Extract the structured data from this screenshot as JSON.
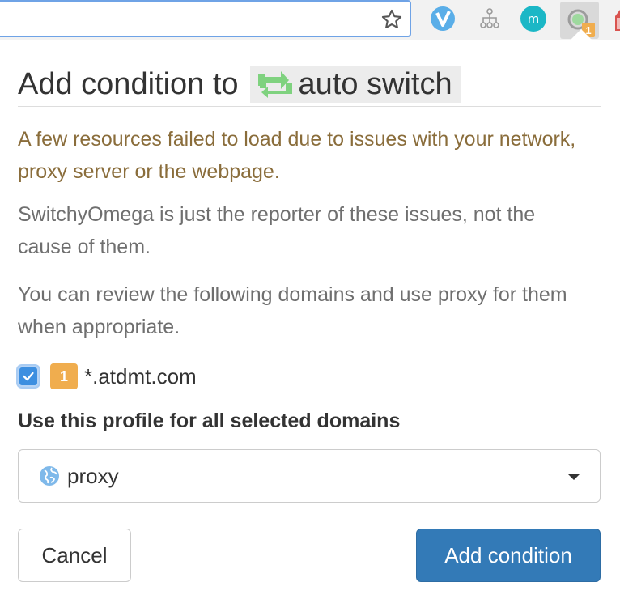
{
  "browser": {
    "star_icon": "star-icon",
    "extensions": [
      "v-extension-icon",
      "sitemap-extension-icon",
      "m-extension-icon",
      "switchyomega-extension-icon"
    ],
    "m_extension_letter": "m",
    "omega_badge": "1"
  },
  "popup": {
    "title_prefix": "Add condition to",
    "title_profile": "auto switch",
    "warning": "A few resources failed to load due to issues with your network, proxy server or the webpage.",
    "reporter_note": "SwitchyOmega is just the reporter of these issues, not the cause of them.",
    "review_note": "You can review the following domains and use proxy for them when appropriate.",
    "domains": [
      {
        "checked": true,
        "count": "1",
        "domain": "*.atdmt.com"
      }
    ],
    "profile_label": "Use this profile for all selected domains",
    "selected_profile": "proxy",
    "cancel_label": "Cancel",
    "add_label": "Add condition"
  },
  "colors": {
    "warning_text": "#8a6d3b",
    "primary_button": "#337ab7",
    "badge": "#f0ad4e",
    "switch_icon": "#7fd27f",
    "globe": "#7fb9ea"
  }
}
